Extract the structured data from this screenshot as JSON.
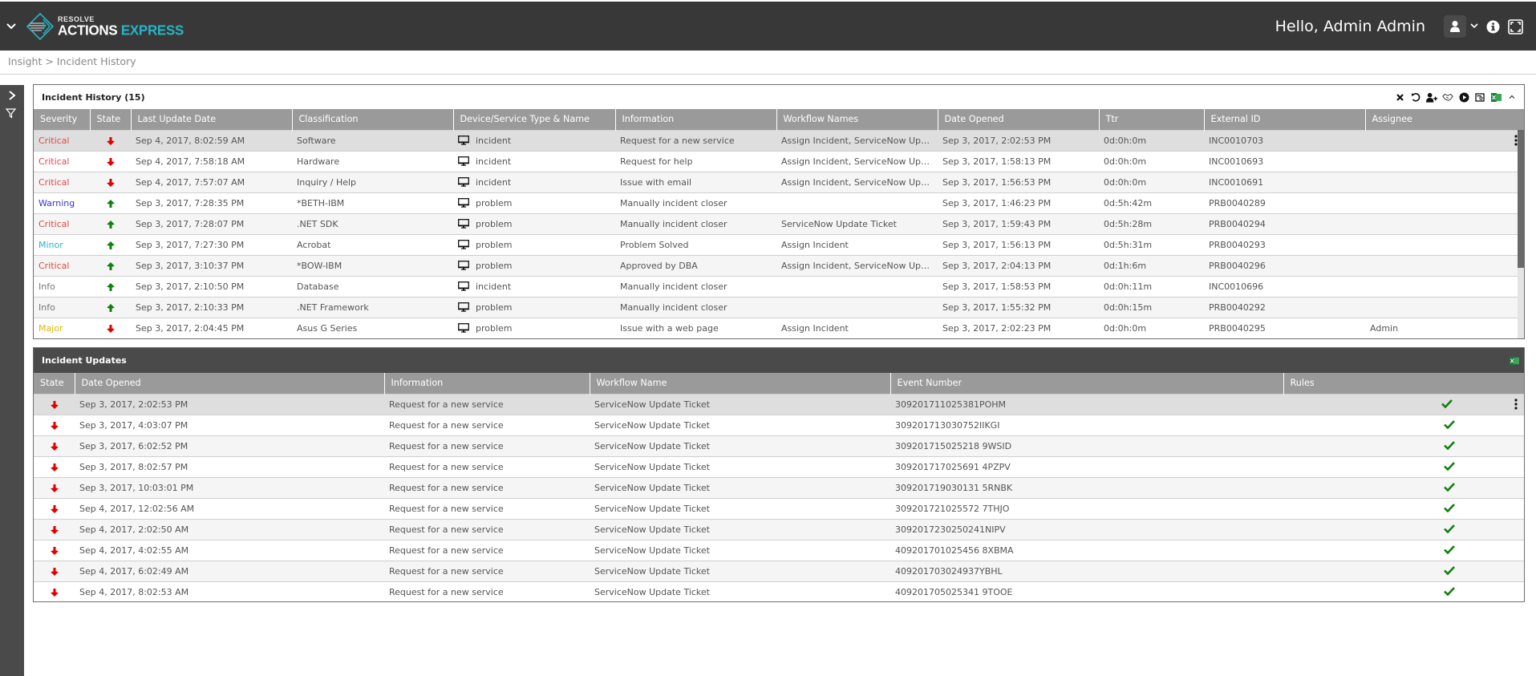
{
  "header": {
    "logo_small": "RESOLVE",
    "logo_main": "ACTIONS",
    "logo_accent": "EXPRESS",
    "greeting": "Hello, Admin Admin"
  },
  "breadcrumb": "Insight > Incident History",
  "colors": {
    "critical": "#e04848",
    "warning": "#3535d0",
    "minor": "#27b4c4",
    "info": "#777777",
    "major": "#e8b200",
    "state_down": "#e00000",
    "state_up": "#108010",
    "check": "#108010",
    "accent": "#27b4c4"
  },
  "history": {
    "title": "Incident History (15)",
    "columns": [
      "Severity",
      "State",
      "Last Update Date",
      "Classification",
      "Device/Service Type & Name",
      "Information",
      "Workflow Names",
      "Date Opened",
      "Ttr",
      "External ID",
      "Assignee"
    ],
    "rows": [
      {
        "severity": "Critical",
        "state": "down",
        "last_update": "Sep 4, 2017, 8:02:59 AM",
        "classification": "Software",
        "device": "incident",
        "information": "Request for a new service",
        "workflows": "Assign Incident, ServiceNow Updat...",
        "date_opened": "Sep 3, 2017, 2:02:53 PM",
        "ttr": "0d:0h:0m",
        "external_id": "INC0010703",
        "assignee": ""
      },
      {
        "severity": "Critical",
        "state": "down",
        "last_update": "Sep 4, 2017, 7:58:18 AM",
        "classification": "Hardware",
        "device": "incident",
        "information": "Request for help",
        "workflows": "Assign Incident, ServiceNow Updat...",
        "date_opened": "Sep 3, 2017, 1:58:13 PM",
        "ttr": "0d:0h:0m",
        "external_id": "INC0010693",
        "assignee": ""
      },
      {
        "severity": "Critical",
        "state": "down",
        "last_update": "Sep 4, 2017, 7:57:07 AM",
        "classification": "Inquiry / Help",
        "device": "incident",
        "information": "Issue with email",
        "workflows": "Assign Incident, ServiceNow Updat...",
        "date_opened": "Sep 3, 2017, 1:56:53 PM",
        "ttr": "0d:0h:0m",
        "external_id": "INC0010691",
        "assignee": ""
      },
      {
        "severity": "Warning",
        "state": "up",
        "last_update": "Sep 3, 2017, 7:28:35 PM",
        "classification": "*BETH-IBM",
        "device": "problem",
        "information": "Manually incident closer",
        "workflows": "",
        "date_opened": "Sep 3, 2017, 1:46:23 PM",
        "ttr": "0d:5h:42m",
        "external_id": "PRB0040289",
        "assignee": ""
      },
      {
        "severity": "Critical",
        "state": "up",
        "last_update": "Sep 3, 2017, 7:28:07 PM",
        "classification": ".NET SDK",
        "device": "problem",
        "information": "Manually incident closer",
        "workflows": "ServiceNow Update Ticket",
        "date_opened": "Sep 3, 2017, 1:59:43 PM",
        "ttr": "0d:5h:28m",
        "external_id": "PRB0040294",
        "assignee": ""
      },
      {
        "severity": "Minor",
        "state": "up",
        "last_update": "Sep 3, 2017, 7:27:30 PM",
        "classification": "Acrobat",
        "device": "problem",
        "information": "Problem Solved",
        "workflows": "Assign Incident",
        "date_opened": "Sep 3, 2017, 1:56:13 PM",
        "ttr": "0d:5h:31m",
        "external_id": "PRB0040293",
        "assignee": ""
      },
      {
        "severity": "Critical",
        "state": "up",
        "last_update": "Sep 3, 2017, 3:10:37 PM",
        "classification": "*BOW-IBM",
        "device": "problem",
        "information": "Approved by DBA",
        "workflows": "Assign Incident, ServiceNow Updat...",
        "date_opened": "Sep 3, 2017, 2:04:13 PM",
        "ttr": "0d:1h:6m",
        "external_id": "PRB0040296",
        "assignee": ""
      },
      {
        "severity": "Info",
        "state": "up",
        "last_update": "Sep 3, 2017, 2:10:50 PM",
        "classification": "Database",
        "device": "incident",
        "information": "Manually incident closer",
        "workflows": "",
        "date_opened": "Sep 3, 2017, 1:58:53 PM",
        "ttr": "0d:0h:11m",
        "external_id": "INC0010696",
        "assignee": ""
      },
      {
        "severity": "Info",
        "state": "up",
        "last_update": "Sep 3, 2017, 2:10:33 PM",
        "classification": ".NET Framework",
        "device": "problem",
        "information": "Manually incident closer",
        "workflows": "",
        "date_opened": "Sep 3, 2017, 1:55:32 PM",
        "ttr": "0d:0h:15m",
        "external_id": "PRB0040292",
        "assignee": ""
      },
      {
        "severity": "Major",
        "state": "down",
        "last_update": "Sep 3, 2017, 2:04:45 PM",
        "classification": "Asus G Series",
        "device": "problem",
        "information": "Issue with a web page",
        "workflows": "Assign Incident",
        "date_opened": "Sep 3, 2017, 2:02:23 PM",
        "ttr": "0d:0h:0m",
        "external_id": "PRB0040295",
        "assignee": "Admin"
      }
    ],
    "tools": [
      "close-icon",
      "refresh-icon",
      "assign-user-icon",
      "handshake-icon",
      "run-icon",
      "report-icon",
      "excel-export-icon",
      "collapse-icon"
    ]
  },
  "updates": {
    "title": "Incident Updates",
    "columns": [
      "State",
      "Date Opened",
      "Information",
      "Workflow Name",
      "Event Number",
      "Rules"
    ],
    "rows": [
      {
        "state": "down",
        "date_opened": "Sep 3, 2017, 2:02:53 PM",
        "information": "Request for a new service",
        "workflow": "ServiceNow Update Ticket",
        "event_number": "309201711025381POHM",
        "rules": "check"
      },
      {
        "state": "down",
        "date_opened": "Sep 3, 2017, 4:03:07 PM",
        "information": "Request for a new service",
        "workflow": "ServiceNow Update Ticket",
        "event_number": "309201713030752IIKGI",
        "rules": "check"
      },
      {
        "state": "down",
        "date_opened": "Sep 3, 2017, 6:02:52 PM",
        "information": "Request for a new service",
        "workflow": "ServiceNow Update Ticket",
        "event_number": "309201715025218 9WSID",
        "rules": "check"
      },
      {
        "state": "down",
        "date_opened": "Sep 3, 2017, 8:02:57 PM",
        "information": "Request for a new service",
        "workflow": "ServiceNow Update Ticket",
        "event_number": "309201717025691 4PZPV",
        "rules": "check"
      },
      {
        "state": "down",
        "date_opened": "Sep 3, 2017, 10:03:01 PM",
        "information": "Request for a new service",
        "workflow": "ServiceNow Update Ticket",
        "event_number": "309201719030131 5RNBK",
        "rules": "check"
      },
      {
        "state": "down",
        "date_opened": "Sep 4, 2017, 12:02:56 AM",
        "information": "Request for a new service",
        "workflow": "ServiceNow Update Ticket",
        "event_number": "309201721025572 7THJO",
        "rules": "check"
      },
      {
        "state": "down",
        "date_opened": "Sep 4, 2017, 2:02:50 AM",
        "information": "Request for a new service",
        "workflow": "ServiceNow Update Ticket",
        "event_number": "3092017230250241NIPV",
        "rules": "check"
      },
      {
        "state": "down",
        "date_opened": "Sep 4, 2017, 4:02:55 AM",
        "information": "Request for a new service",
        "workflow": "ServiceNow Update Ticket",
        "event_number": "409201701025456 8XBMA",
        "rules": "check"
      },
      {
        "state": "down",
        "date_opened": "Sep 4, 2017, 6:02:49 AM",
        "information": "Request for a new service",
        "workflow": "ServiceNow Update Ticket",
        "event_number": "409201703024937YBHL",
        "rules": "check"
      },
      {
        "state": "down",
        "date_opened": "Sep 4, 2017, 8:02:53 AM",
        "information": "Request for a new service",
        "workflow": "ServiceNow Update Ticket",
        "event_number": "409201705025341 9TOOE",
        "rules": "check"
      }
    ]
  }
}
